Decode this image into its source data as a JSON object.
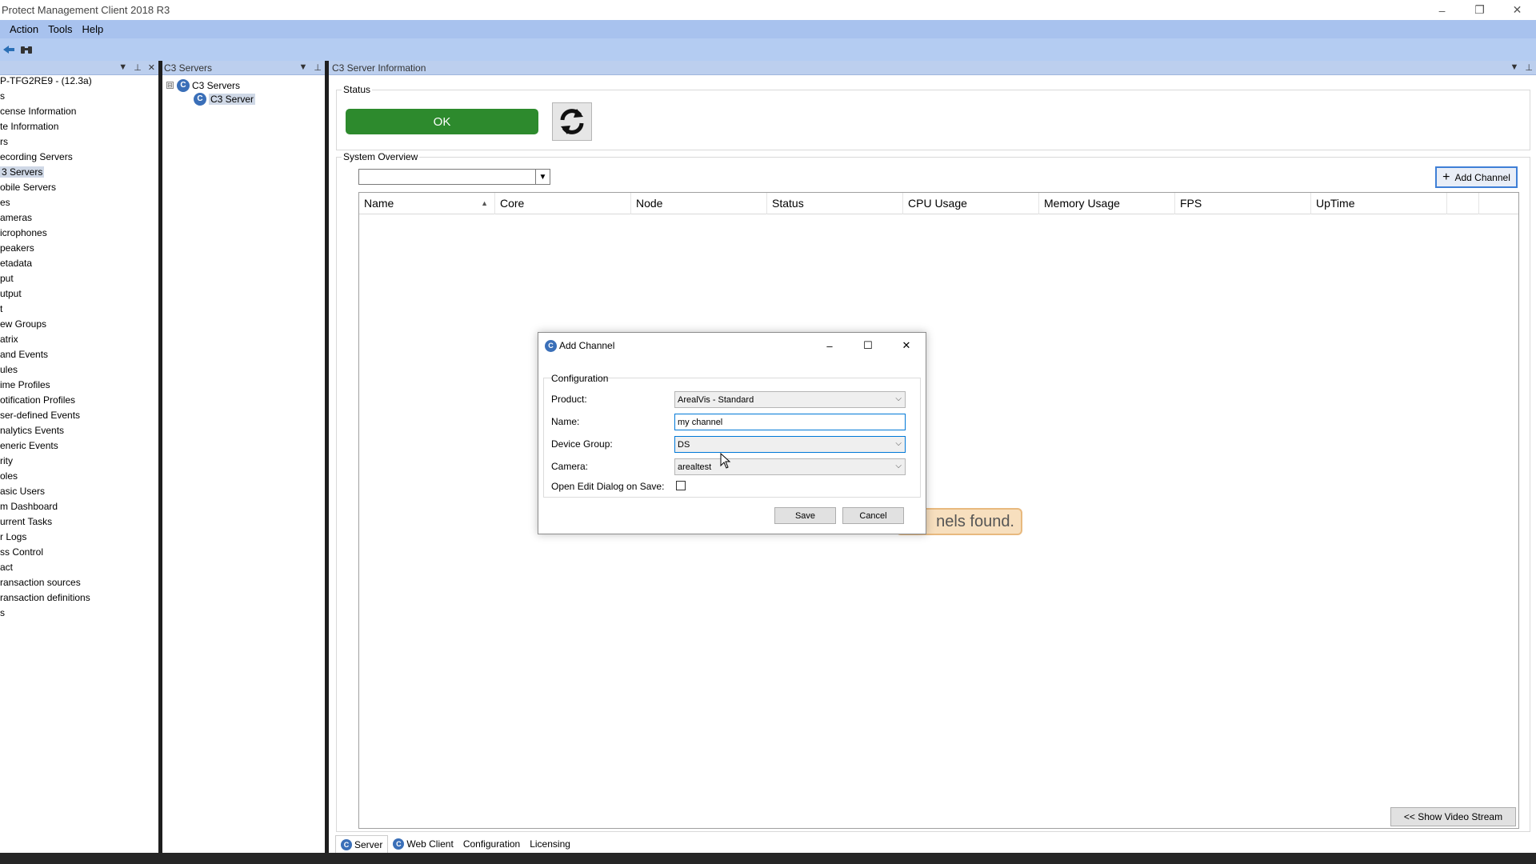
{
  "window": {
    "title": "Protect Management Client 2018 R3",
    "controls": {
      "minimize": "–",
      "restore": "❐",
      "close": "✕"
    }
  },
  "menu": {
    "items": [
      "Action",
      "Tools",
      "Help"
    ]
  },
  "toolbar": {
    "icons": [
      "back-icon",
      "binoculars-icon"
    ]
  },
  "left_pane": {
    "root": "P-TFG2RE9 - (12.3a)",
    "items": [
      "s",
      "cense Information",
      "te Information",
      "rs",
      "ecording Servers",
      "3 Servers",
      "obile Servers",
      "es",
      "ameras",
      "icrophones",
      "peakers",
      "etadata",
      "put",
      "utput",
      "t",
      "ew Groups",
      "atrix",
      "and Events",
      "ules",
      "ime Profiles",
      "otification Profiles",
      "ser-defined Events",
      "nalytics Events",
      "eneric Events",
      "rity",
      "oles",
      "asic Users",
      "m Dashboard",
      "urrent Tasks",
      "r Logs",
      "ss Control",
      "act",
      "ransaction sources",
      "ransaction definitions",
      "s"
    ],
    "selected_index": 5
  },
  "c3_pane": {
    "header": "C3 Servers",
    "tree": {
      "root": "C3 Servers",
      "child": "C3 Server",
      "expander": "⊟"
    }
  },
  "main_pane": {
    "header": "C3 Server Information",
    "status_label": "Status",
    "ok_label": "OK",
    "overview_label": "System Overview",
    "add_channel_label": "Add Channel",
    "columns": [
      "Name",
      "Core",
      "Node",
      "Status",
      "CPU Usage",
      "Memory Usage",
      "FPS",
      "UpTime"
    ],
    "empty_message": "nels found.",
    "show_video_label": "<< Show Video Stream"
  },
  "bottom_tabs": [
    "Server",
    "Web Client",
    "Configuration",
    "Licensing"
  ],
  "dialog": {
    "title": "Add Channel",
    "group_label": "Configuration",
    "product_label": "Product:",
    "product_value": "ArealVis - Standard",
    "name_label": "Name:",
    "name_value": "my channel",
    "device_group_label": "Device Group:",
    "device_group_value": "DS",
    "camera_label": "Camera:",
    "camera_value": "arealtest",
    "open_edit_label": "Open Edit Dialog on Save:",
    "save_label": "Save",
    "cancel_label": "Cancel"
  },
  "colors": {
    "ok_green": "#2d8a2d",
    "menu_blue": "#a8c2ee",
    "accent_blue": "#3f7fd6"
  }
}
